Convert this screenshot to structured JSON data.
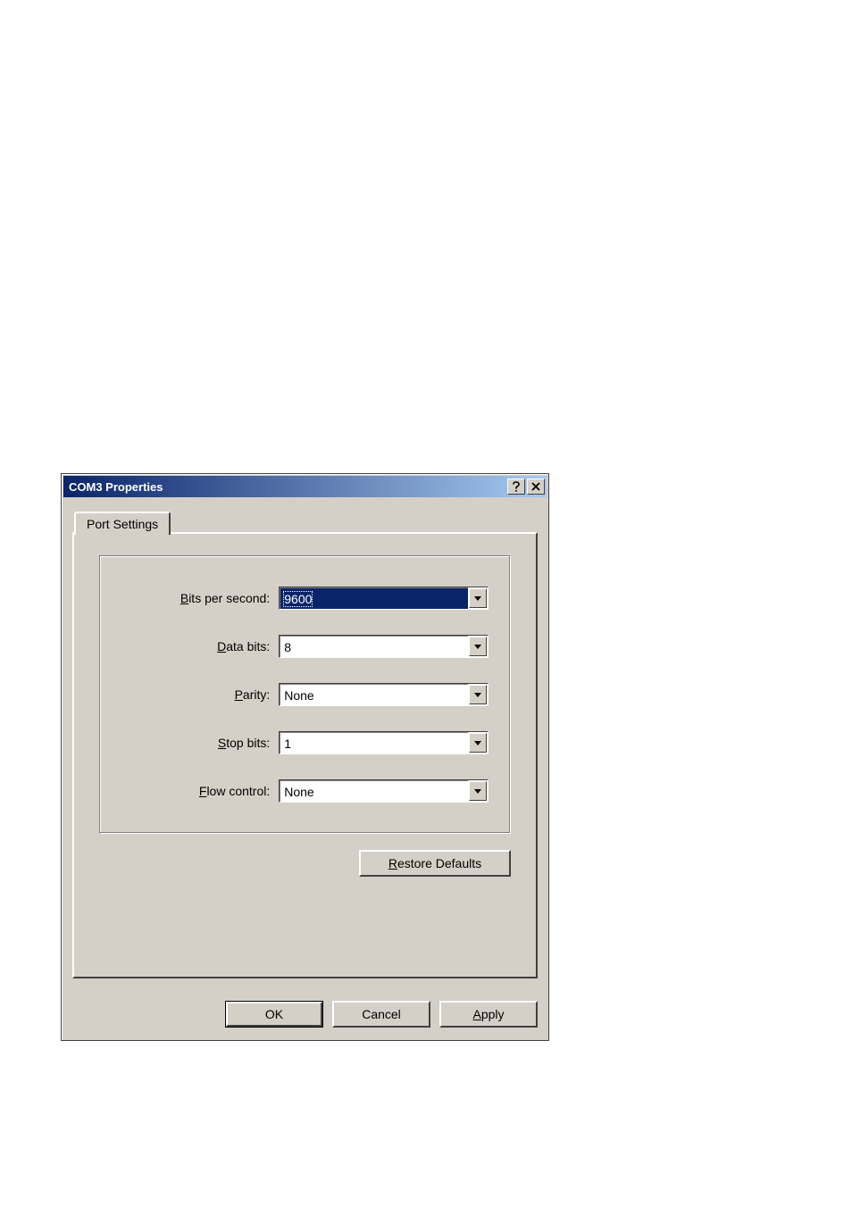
{
  "window": {
    "title": "COM3 Properties"
  },
  "tab": {
    "label": "Port Settings"
  },
  "fields": {
    "bits_per_second": {
      "label_pre": "",
      "label_accel": "B",
      "label_post": "its per second:",
      "value": "9600"
    },
    "data_bits": {
      "label_pre": "",
      "label_accel": "D",
      "label_post": "ata bits:",
      "value": "8"
    },
    "parity": {
      "label_pre": "",
      "label_accel": "P",
      "label_post": "arity:",
      "value": "None"
    },
    "stop_bits": {
      "label_pre": "",
      "label_accel": "S",
      "label_post": "top bits:",
      "value": "1"
    },
    "flow_control": {
      "label_pre": "",
      "label_accel": "F",
      "label_post": "low control:",
      "value": "None"
    }
  },
  "buttons": {
    "restore_defaults": {
      "accel": "R",
      "post": "estore Defaults"
    },
    "ok": "OK",
    "cancel": "Cancel",
    "apply": {
      "accel": "A",
      "post": "pply"
    }
  }
}
